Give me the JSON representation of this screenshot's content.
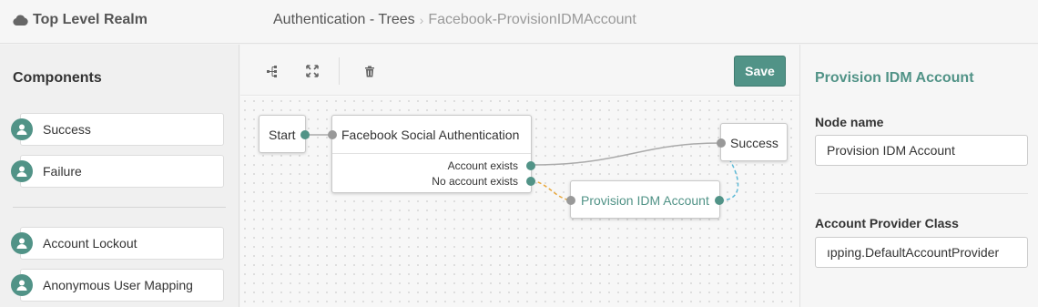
{
  "header": {
    "realm": "Top Level Realm",
    "breadcrumb_root": "Authentication - Trees",
    "breadcrumb_separator": "›",
    "breadcrumb_current": "Facebook-ProvisionIDMAccount"
  },
  "components": {
    "title": "Components",
    "items": [
      "Success",
      "Failure",
      "Account Lockout",
      "Anonymous User Mapping"
    ]
  },
  "toolbar": {
    "save_label": "Save",
    "icons": [
      "tree-layout-icon",
      "fullscreen-icon",
      "trash-icon"
    ]
  },
  "canvas": {
    "start_label": "Start",
    "facebook_node": {
      "title": "Facebook Social Authentication",
      "outcomes": [
        "Account exists",
        "No account exists"
      ]
    },
    "success_label": "Success",
    "provision_label": "Provision IDM Account"
  },
  "properties": {
    "title": "Provision IDM Account",
    "node_name_label": "Node name",
    "node_name_value": "Provision IDM Account",
    "provider_label": "Account Provider Class",
    "provider_value": "ıpping.DefaultAccountProvider"
  },
  "colors": {
    "accent": "#519387",
    "link_gray": "#aaaaaa",
    "link_orange": "#e8a83c",
    "link_blue": "#5ab9d6"
  }
}
